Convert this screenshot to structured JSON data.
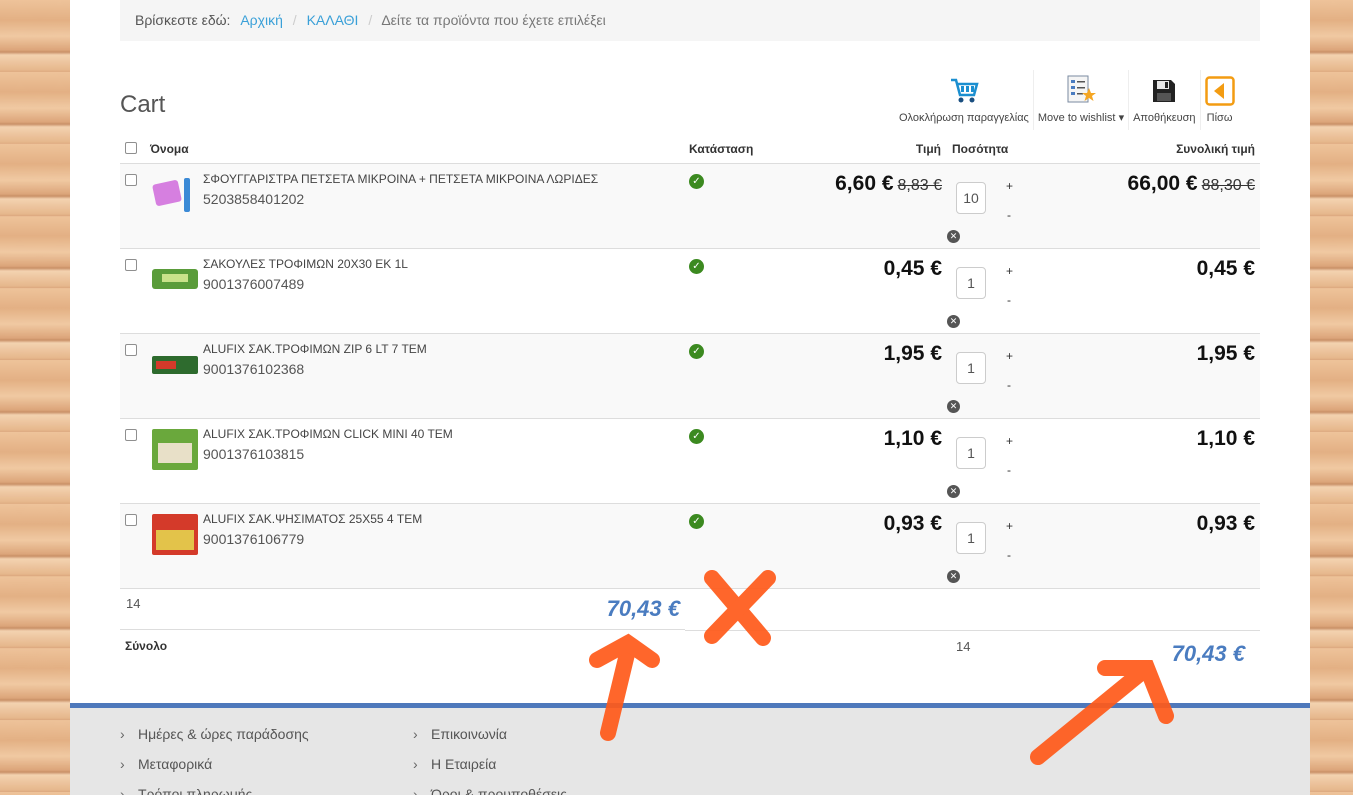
{
  "breadcrumb": {
    "lead": "Βρίσκεστε εδώ:",
    "items": [
      "Αρχική",
      "ΚΑΛΑΘΙ"
    ],
    "current": "Δείτε τα προϊόντα που έχετε επιλέξει"
  },
  "cart_title": "Cart",
  "toolbar": {
    "checkout": "Ολοκλήρωση παραγγελίας",
    "wishlist": "Move to wishlist",
    "save": "Αποθήκευση",
    "back": "Πίσω"
  },
  "table": {
    "headers": {
      "name": "Όνομα",
      "status": "Κατάσταση",
      "price": "Τιμή",
      "qty": "Ποσότητα",
      "total": "Συνολική τιμή"
    },
    "rows": [
      {
        "name": "ΣΦΟΥΓΓΑΡΙΣΤΡΑ ΠΕΤΣΕΤΑ ΜΙΚΡΟΙΝΑ + ΠΕΤΣΕΤΑ ΜΙΚΡΟΙΝΑ ΛΩΡΙΔΕΣ",
        "code": "5203858401202",
        "price": "6,60 €",
        "old_price": "8,83 €",
        "qty": "10",
        "total": "66,00 €",
        "old_total": "88,30 €",
        "thumb": "mop"
      },
      {
        "name": "ΣΑΚΟΥΛΕΣ ΤΡΟΦΙΜΩΝ 20Χ30 ΕΚ 1L",
        "code": "9001376007489",
        "price": "0,45 €",
        "old_price": "",
        "qty": "1",
        "total": "0,45 €",
        "old_total": "",
        "thumb": "bags"
      },
      {
        "name": "ALUFIX ΣΑΚ.ΤΡΟΦΙΜΩΝ ZIP 6 LT 7 TEM",
        "code": "9001376102368",
        "price": "1,95 €",
        "old_price": "",
        "qty": "1",
        "total": "1,95 €",
        "old_total": "",
        "thumb": "zip"
      },
      {
        "name": "ALUFIX ΣΑΚ.ΤΡΟΦΙΜΩΝ CLICK MINI 40 TEM",
        "code": "9001376103815",
        "price": "1,10 €",
        "old_price": "",
        "qty": "1",
        "total": "1,10 €",
        "old_total": "",
        "thumb": "click"
      },
      {
        "name": "ALUFIX ΣΑΚ.ΨΗΣΙΜΑΤΟΣ 25Χ55 4 TEM",
        "code": "9001376106779",
        "price": "0,93 €",
        "old_price": "",
        "qty": "1",
        "total": "0,93 €",
        "old_total": "",
        "thumb": "roast"
      }
    ]
  },
  "subtotal": {
    "count": "14",
    "amount": "70,43 €"
  },
  "summary": {
    "label": "Σύνολο",
    "count": "14",
    "amount": "70,43 €"
  },
  "footer": {
    "col1": [
      "Ημέρες & ώρες παράδοσης",
      "Μεταφορικά",
      "Τρόποι πληρωμής"
    ],
    "col2": [
      "Επικοινωνία",
      "Η Εταιρεία",
      "Όροι & προυποθέσεις"
    ]
  },
  "colors": {
    "link": "#3aa0d8",
    "status_ok": "#3c8a20",
    "sum_amount": "#4a7cc0",
    "footer_border": "#4e78bb",
    "annotation": "#ff5a1a"
  },
  "icons": [
    "cart-icon",
    "wishlist-icon",
    "save-disk-icon",
    "back-arrow-icon",
    "check-circle-icon",
    "remove-x-icon",
    "chevron-right-icon"
  ]
}
